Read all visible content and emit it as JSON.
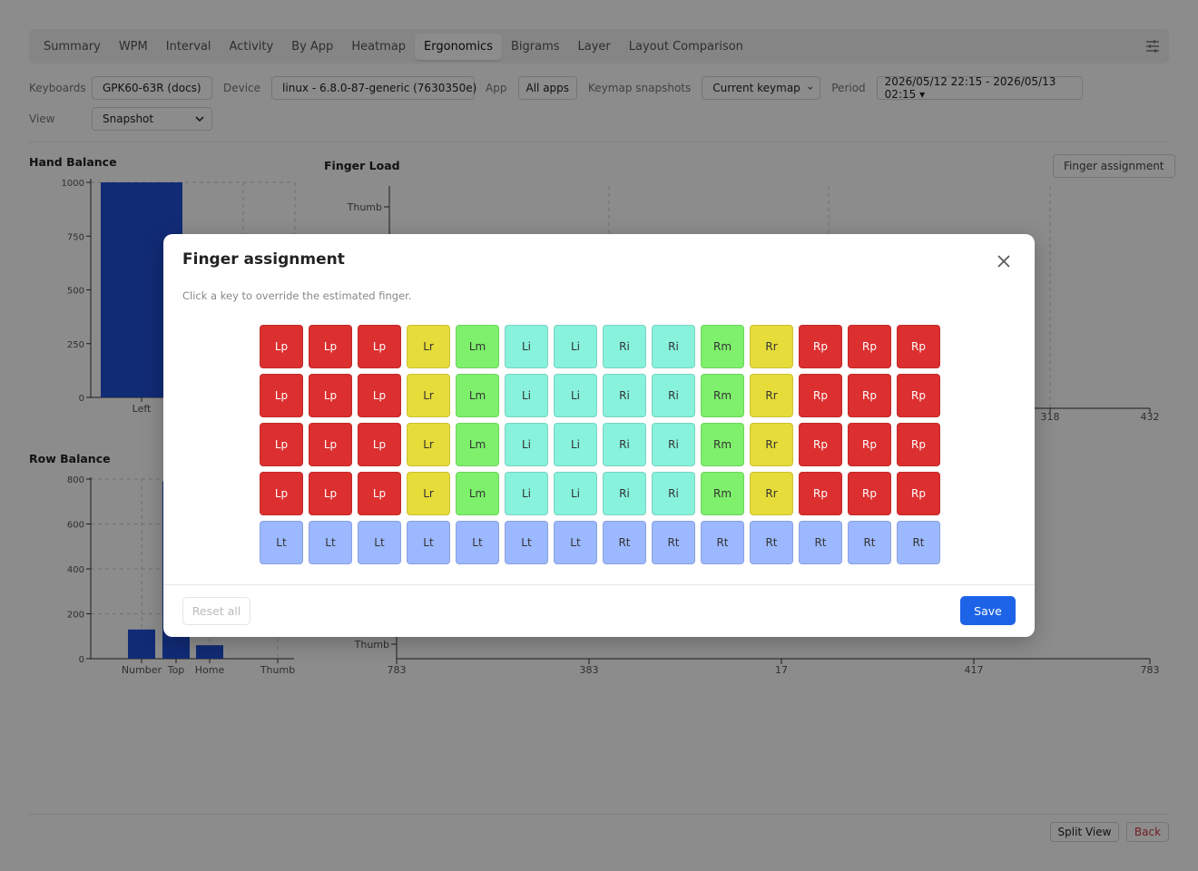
{
  "tabs": [
    "Summary",
    "WPM",
    "Interval",
    "Activity",
    "By App",
    "Heatmap",
    "Ergonomics",
    "Bigrams",
    "Layer",
    "Layout Comparison"
  ],
  "active_tab": "Ergonomics",
  "filters": {
    "keyboards_label": "Keyboards",
    "keyboards_value": "GPK60-63R (docs)",
    "device_label": "Device",
    "device_value": "linux - 6.8.0-87-generic (7630350e)",
    "app_label": "App",
    "app_value": "All apps",
    "snapshots_label": "Keymap snapshots",
    "snapshots_value": "Current keymap",
    "period_label": "Period",
    "period_value": "2026/05/12 22:15 - 2026/05/13 02:15 ▾",
    "view_label": "View",
    "view_value": "Snapshot"
  },
  "hand_balance": {
    "title": "Hand Balance",
    "yticks": [
      "1000",
      "750",
      "500",
      "250",
      "0"
    ],
    "xlabel_left": "Left"
  },
  "finger_load": {
    "title": "Finger Load",
    "assign_button": "Finger assignment",
    "thumb_label": "Thumb",
    "x_ticks_right": [
      "318",
      "432"
    ]
  },
  "row_balance": {
    "title": "Row Balance",
    "yticks": [
      "800",
      "600",
      "400",
      "200",
      "0"
    ],
    "categories": [
      "Number",
      "Top",
      "Home",
      "Thumb"
    ]
  },
  "lower_right": {
    "thumb_label": "Thumb",
    "x_ticks": [
      "783",
      "383",
      "17",
      "417",
      "783"
    ]
  },
  "chart_data": [
    {
      "type": "bar",
      "title": "Hand Balance",
      "categories": [
        "Left"
      ],
      "values": [
        1000
      ],
      "ylim": [
        0,
        1000
      ]
    },
    {
      "type": "bar",
      "title": "Row Balance",
      "categories": [
        "Number",
        "Top",
        "Home",
        "Thumb"
      ],
      "values": [
        130,
        790,
        60,
        0
      ],
      "ylim": [
        0,
        800
      ]
    }
  ],
  "modal": {
    "title": "Finger assignment",
    "hint": "Click a key to override the estimated finger.",
    "reset_label": "Reset all",
    "save_label": "Save",
    "rows": [
      [
        "Lp",
        "Lp",
        "Lp",
        "Lr",
        "Lm",
        "Li",
        "Li",
        "Ri",
        "Ri",
        "Rm",
        "Rr",
        "Rp",
        "Rp",
        "Rp"
      ],
      [
        "Lp",
        "Lp",
        "Lp",
        "Lr",
        "Lm",
        "Li",
        "Li",
        "Ri",
        "Ri",
        "Rm",
        "Rr",
        "Rp",
        "Rp",
        "Rp"
      ],
      [
        "Lp",
        "Lp",
        "Lp",
        "Lr",
        "Lm",
        "Li",
        "Li",
        "Ri",
        "Ri",
        "Rm",
        "Rr",
        "Rp",
        "Rp",
        "Rp"
      ],
      [
        "Lp",
        "Lp",
        "Lp",
        "Lr",
        "Lm",
        "Li",
        "Li",
        "Ri",
        "Ri",
        "Rm",
        "Rr",
        "Rp",
        "Rp",
        "Rp"
      ],
      [
        "Lt",
        "Lt",
        "Lt",
        "Lt",
        "Lt",
        "Lt",
        "Lt",
        "Rt",
        "Rt",
        "Rt",
        "Rt",
        "Rt",
        "Rt",
        "Rt"
      ]
    ],
    "finger_colors": {
      "Lp": "#dc2f2f",
      "Rp": "#dc2f2f",
      "Lr": "#e6dc3a",
      "Rr": "#e6dc3a",
      "Lm": "#7ef06c",
      "Rm": "#7ef06c",
      "Li": "#88f2dc",
      "Ri": "#88f2dc",
      "Lt": "#9cb8ff",
      "Rt": "#9cb8ff"
    },
    "finger_text_colors": {
      "Lp": "#ffffff",
      "Rp": "#ffffff"
    }
  },
  "footer": {
    "split_view": "Split View",
    "back": "Back"
  }
}
